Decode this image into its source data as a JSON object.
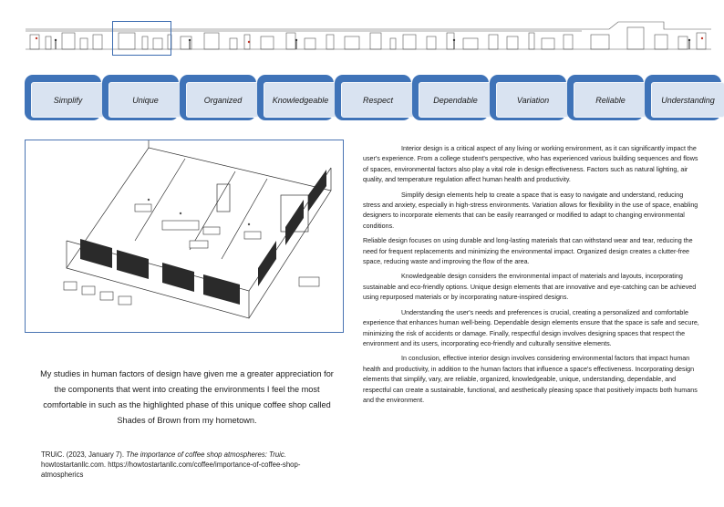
{
  "tabs": [
    "Simplify",
    "Unique",
    "Organized",
    "Knowledgeable",
    "Respect",
    "Dependable",
    "Variation",
    "Reliable",
    "Understanding"
  ],
  "caption": "My studies in human factors of design have given me a greater appreciation for the components that went into creating the environments I feel the most comfortable in such as the highlighted phase of this unique coffee shop called Shades of Brown from my hometown.",
  "citation": {
    "authors": "TRUiC. (2023, January 7).",
    "title": "The importance of coffee shop atmospheres: Truic.",
    "source": "howtostartanllc.com. https://howtostartanllc.com/coffee/importance-of-coffee-shop-atmospherics"
  },
  "essay": {
    "p1": "Interior design is a critical aspect of any living or working environment, as it can significantly impact the user's experience. From a college student's perspective, who has experienced various building sequences and flows of spaces, environmental factors also play a vital role in design effectiveness. Factors such as natural lighting, air quality, and temperature regulation affect human health and productivity.",
    "p2": "Simplify design elements help to create a space that is easy to navigate and understand, reducing stress and anxiety, especially in high-stress environments. Variation allows for flexibility in the use of space, enabling designers to incorporate elements that can be easily rearranged or modified to adapt to changing environmental conditions.",
    "p3": "Reliable design focuses on using durable and long-lasting materials that can withstand wear and tear, reducing the need for frequent replacements and minimizing the environmental impact. Organized design creates a clutter-free space, reducing waste and improving the flow of the area.",
    "p4": "Knowledgeable design considers the environmental impact of materials and layouts, incorporating sustainable and eco-friendly options. Unique design elements that are innovative and eye-catching can be achieved using repurposed materials or by incorporating nature-inspired designs.",
    "p5": "Understanding the user's needs and preferences is crucial, creating a personalized and comfortable experience that enhances human well-being. Dependable design elements ensure that the space is safe and secure, minimizing the risk of accidents or damage. Finally,  respectful design involves designing spaces that respect the environment and its users, incorporating eco-friendly and culturally sensitive elements.",
    "p6": "In conclusion, effective interior design involves considering environmental factors that impact human health and productivity, in addition to the human factors that influence a space's effectiveness. Incorporating design elements that simplify, vary, are reliable, organized, knowledgeable, unique, understanding, dependable, and respectful can create a sustainable, functional, and aesthetically pleasing space that positively impacts both humans and the environment."
  }
}
